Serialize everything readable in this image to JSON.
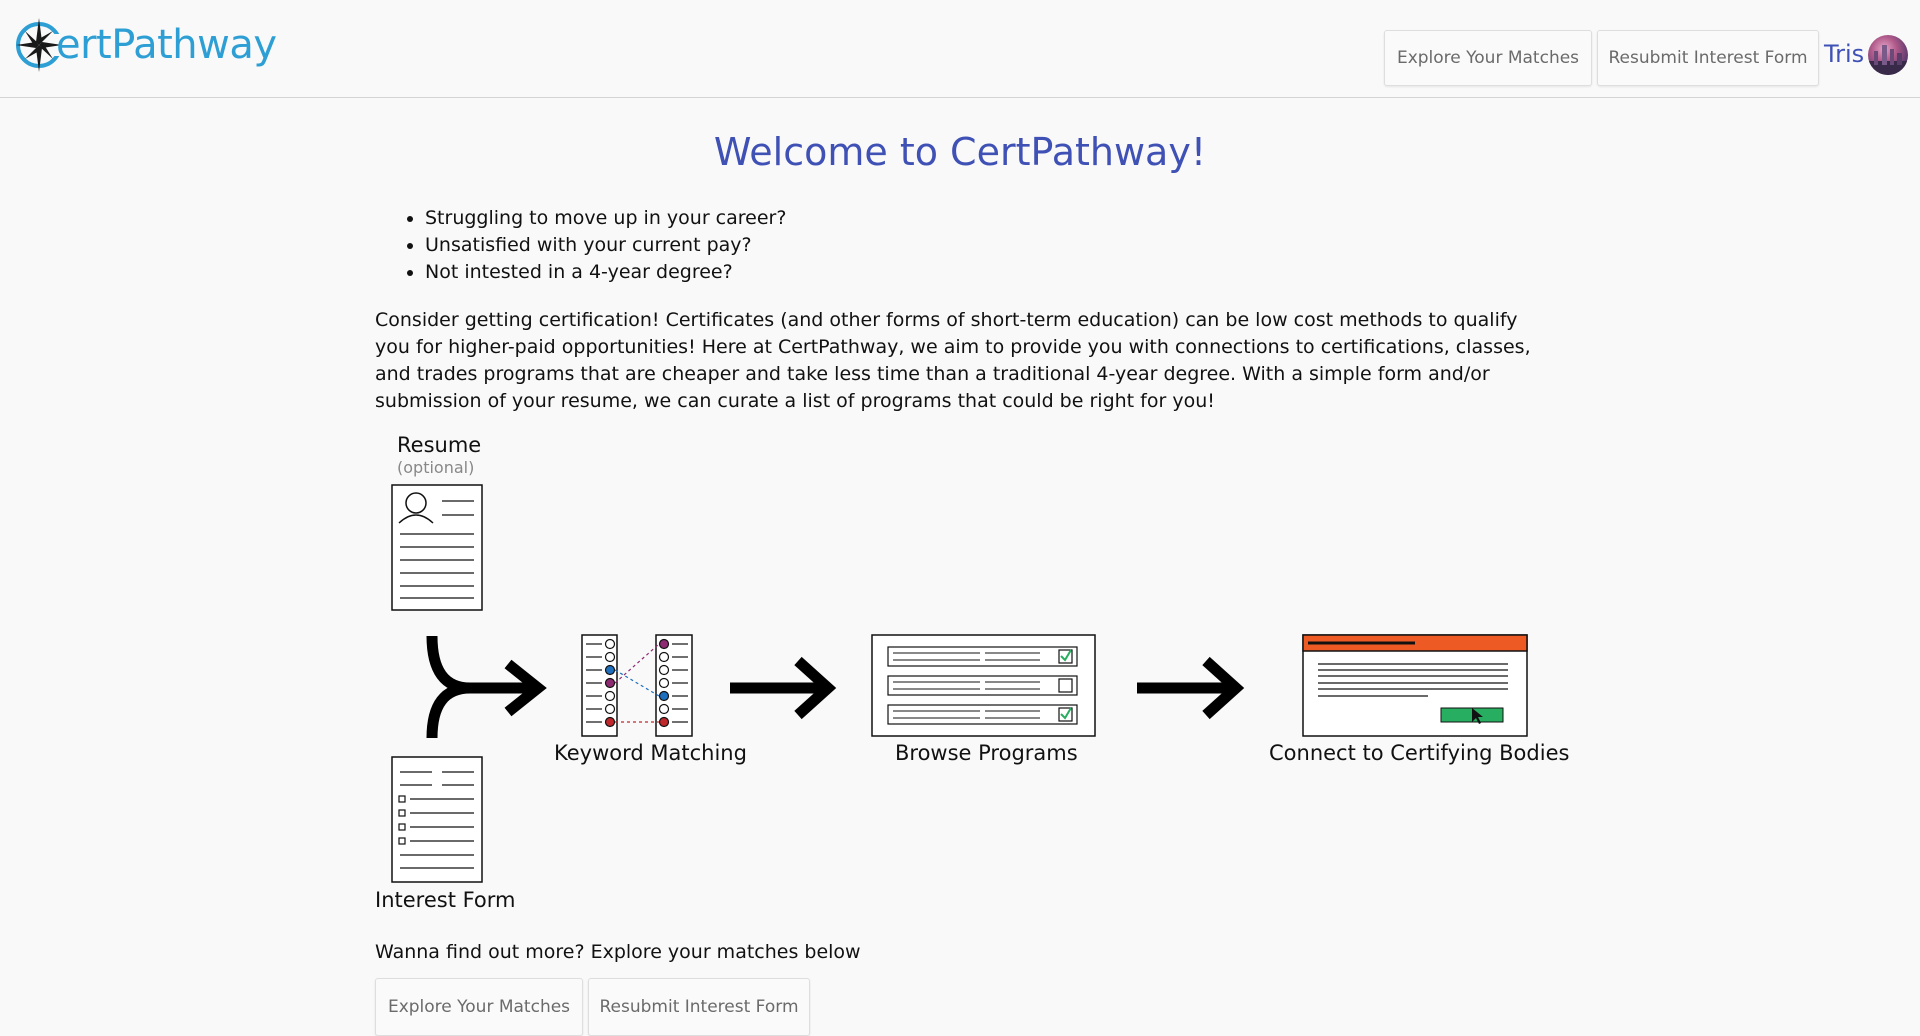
{
  "header": {
    "brand_initial": "C",
    "brand_rest": "ertPathway",
    "nav": {
      "explore_label": "Explore Your Matches",
      "resubmit_label": "Resubmit Interest Form"
    },
    "user_name": "Tris"
  },
  "main": {
    "title": "Welcome to CertPathway!",
    "bullets": [
      "Struggling to move up in your career?",
      "Unsatisfied with your current pay?",
      "Not intested in a 4-year degree?"
    ],
    "intro": "Consider getting certification! Certificates (and other forms of short-term education) can be low cost methods to qualify you for higher-paid opportunities! Here at CertPathway, we aim to provide you with connections to certifications, classes, and trades programs that are cheaper and take less time than a traditional 4-year degree. With a simple form and/or submission of your resume, we can curate a list of programs that could be right for you!",
    "diagram": {
      "resume_label": "Resume",
      "resume_sub": "(optional)",
      "interest_label": "Interest Form",
      "keyword_label": "Keyword Matching",
      "browse_label": "Browse Programs",
      "connect_label": "Connect to Certifying Bodies"
    },
    "cta_text": "Wanna find out more? Explore your matches below",
    "cta_explore_label": "Explore Your Matches",
    "cta_resubmit_label": "Resubmit Interest Form"
  },
  "colors": {
    "brand": "#2e9fd4",
    "title": "#3f51b5",
    "orange": "#ee5a24",
    "green": "#27ae60"
  }
}
